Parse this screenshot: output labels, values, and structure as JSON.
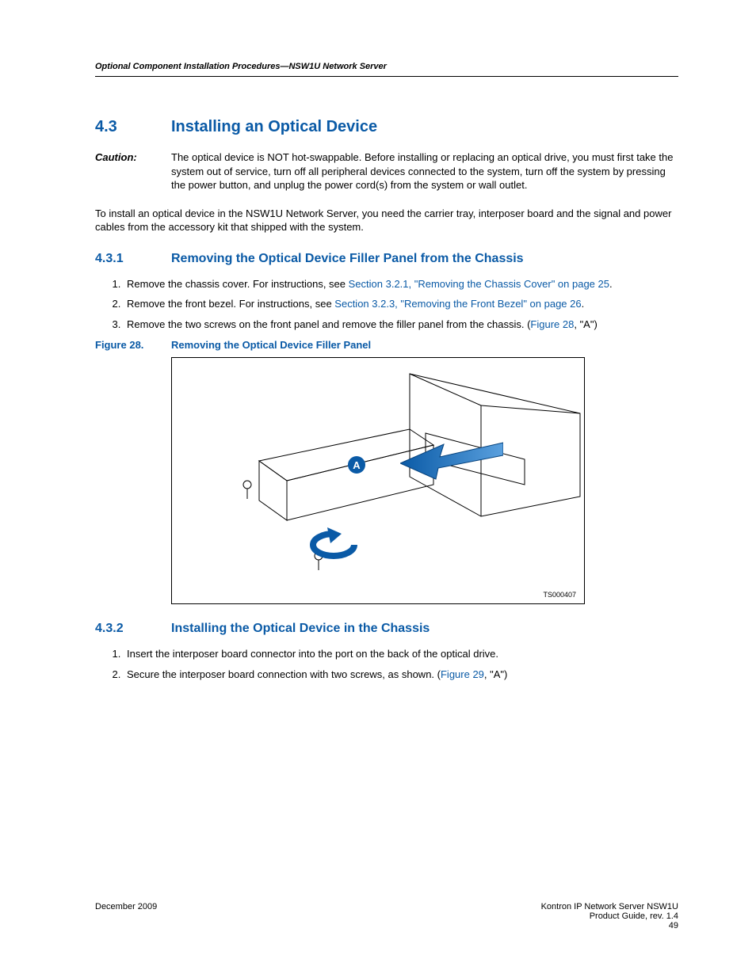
{
  "header": {
    "running": "Optional Component Installation Procedures—NSW1U Network Server"
  },
  "section": {
    "num": "4.3",
    "title": "Installing an Optical Device"
  },
  "caution": {
    "label": "Caution:",
    "text": "The optical device is NOT hot-swappable. Before installing or replacing an optical drive, you must first take the system out of service, turn off all peripheral devices connected to the system, turn off the system by pressing the power button, and unplug the power cord(s) from the system or wall outlet."
  },
  "intro": "To install an optical device in the NSW1U Network Server, you need the carrier tray, interposer board and the signal and power cables from the accessory kit that shipped with the system.",
  "sub1": {
    "num": "4.3.1",
    "title": "Removing the Optical Device Filler Panel from the Chassis",
    "step1_a": "Remove the chassis cover. For instructions, see ",
    "step1_link": "Section 3.2.1, \"Removing the Chassis Cover\" on page 25",
    "step1_c": ".",
    "step2_a": "Remove the front bezel. For instructions, see ",
    "step2_link": "Section 3.2.3, \"Removing the Front Bezel\" on page 26",
    "step2_c": ".",
    "step3_a": "Remove the two screws on the front panel and remove the filler panel from the chassis. (",
    "step3_link": "Figure 28",
    "step3_c": ", \"A\")"
  },
  "figure28": {
    "num": "Figure 28.",
    "title": "Removing the Optical Device Filler Panel",
    "callout": "A",
    "ts": "TS000407"
  },
  "sub2": {
    "num": "4.3.2",
    "title": "Installing the Optical Device in the Chassis",
    "step1": "Insert the interposer board connector into the port on the back of the optical drive.",
    "step2_a": "Secure the interposer board connection with two screws, as shown. (",
    "step2_link": "Figure 29",
    "step2_c": ", \"A\")"
  },
  "footer": {
    "date": "December 2009",
    "product": "Kontron IP Network Server NSW1U",
    "guide": "Product Guide, rev. 1.4",
    "page": "49"
  }
}
